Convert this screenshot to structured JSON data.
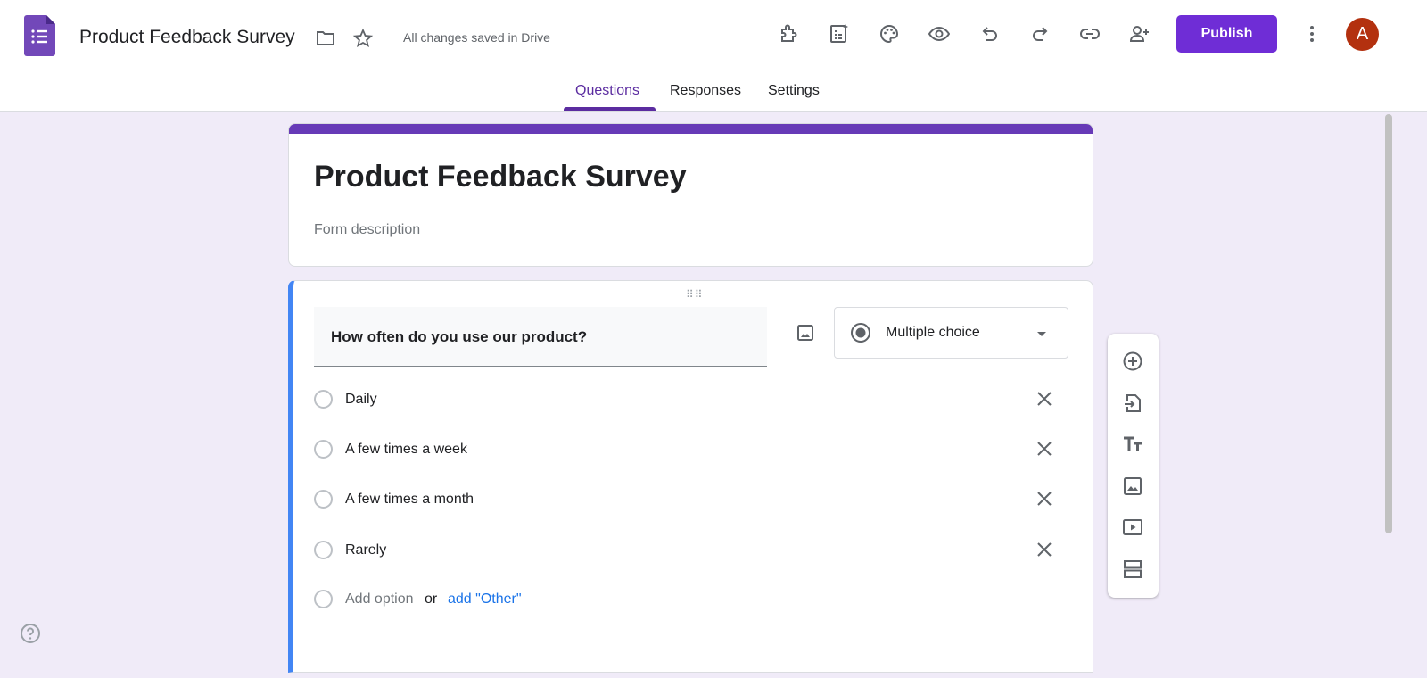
{
  "header": {
    "doc_title": "Product Feedback Survey",
    "save_status": "All changes saved in Drive",
    "publish_label": "Publish",
    "avatar_letter": "A"
  },
  "tabs": [
    {
      "label": "Questions",
      "active": true
    },
    {
      "label": "Responses"
    },
    {
      "label": "Settings"
    }
  ],
  "form": {
    "title": "Product Feedback Survey",
    "description_placeholder": "Form description"
  },
  "question": {
    "text": "How often do you use our product?",
    "type": "Multiple choice",
    "options": [
      "Daily",
      "A few times a week",
      "A few times a month",
      "Rarely"
    ],
    "add_option": "Add option",
    "or": "or",
    "add_other": "add \"Other\""
  },
  "colors": {
    "accent": "#673ab7",
    "publish": "#6f2dd6",
    "active_question": "#4285f4",
    "background": "#f0ebf8"
  }
}
